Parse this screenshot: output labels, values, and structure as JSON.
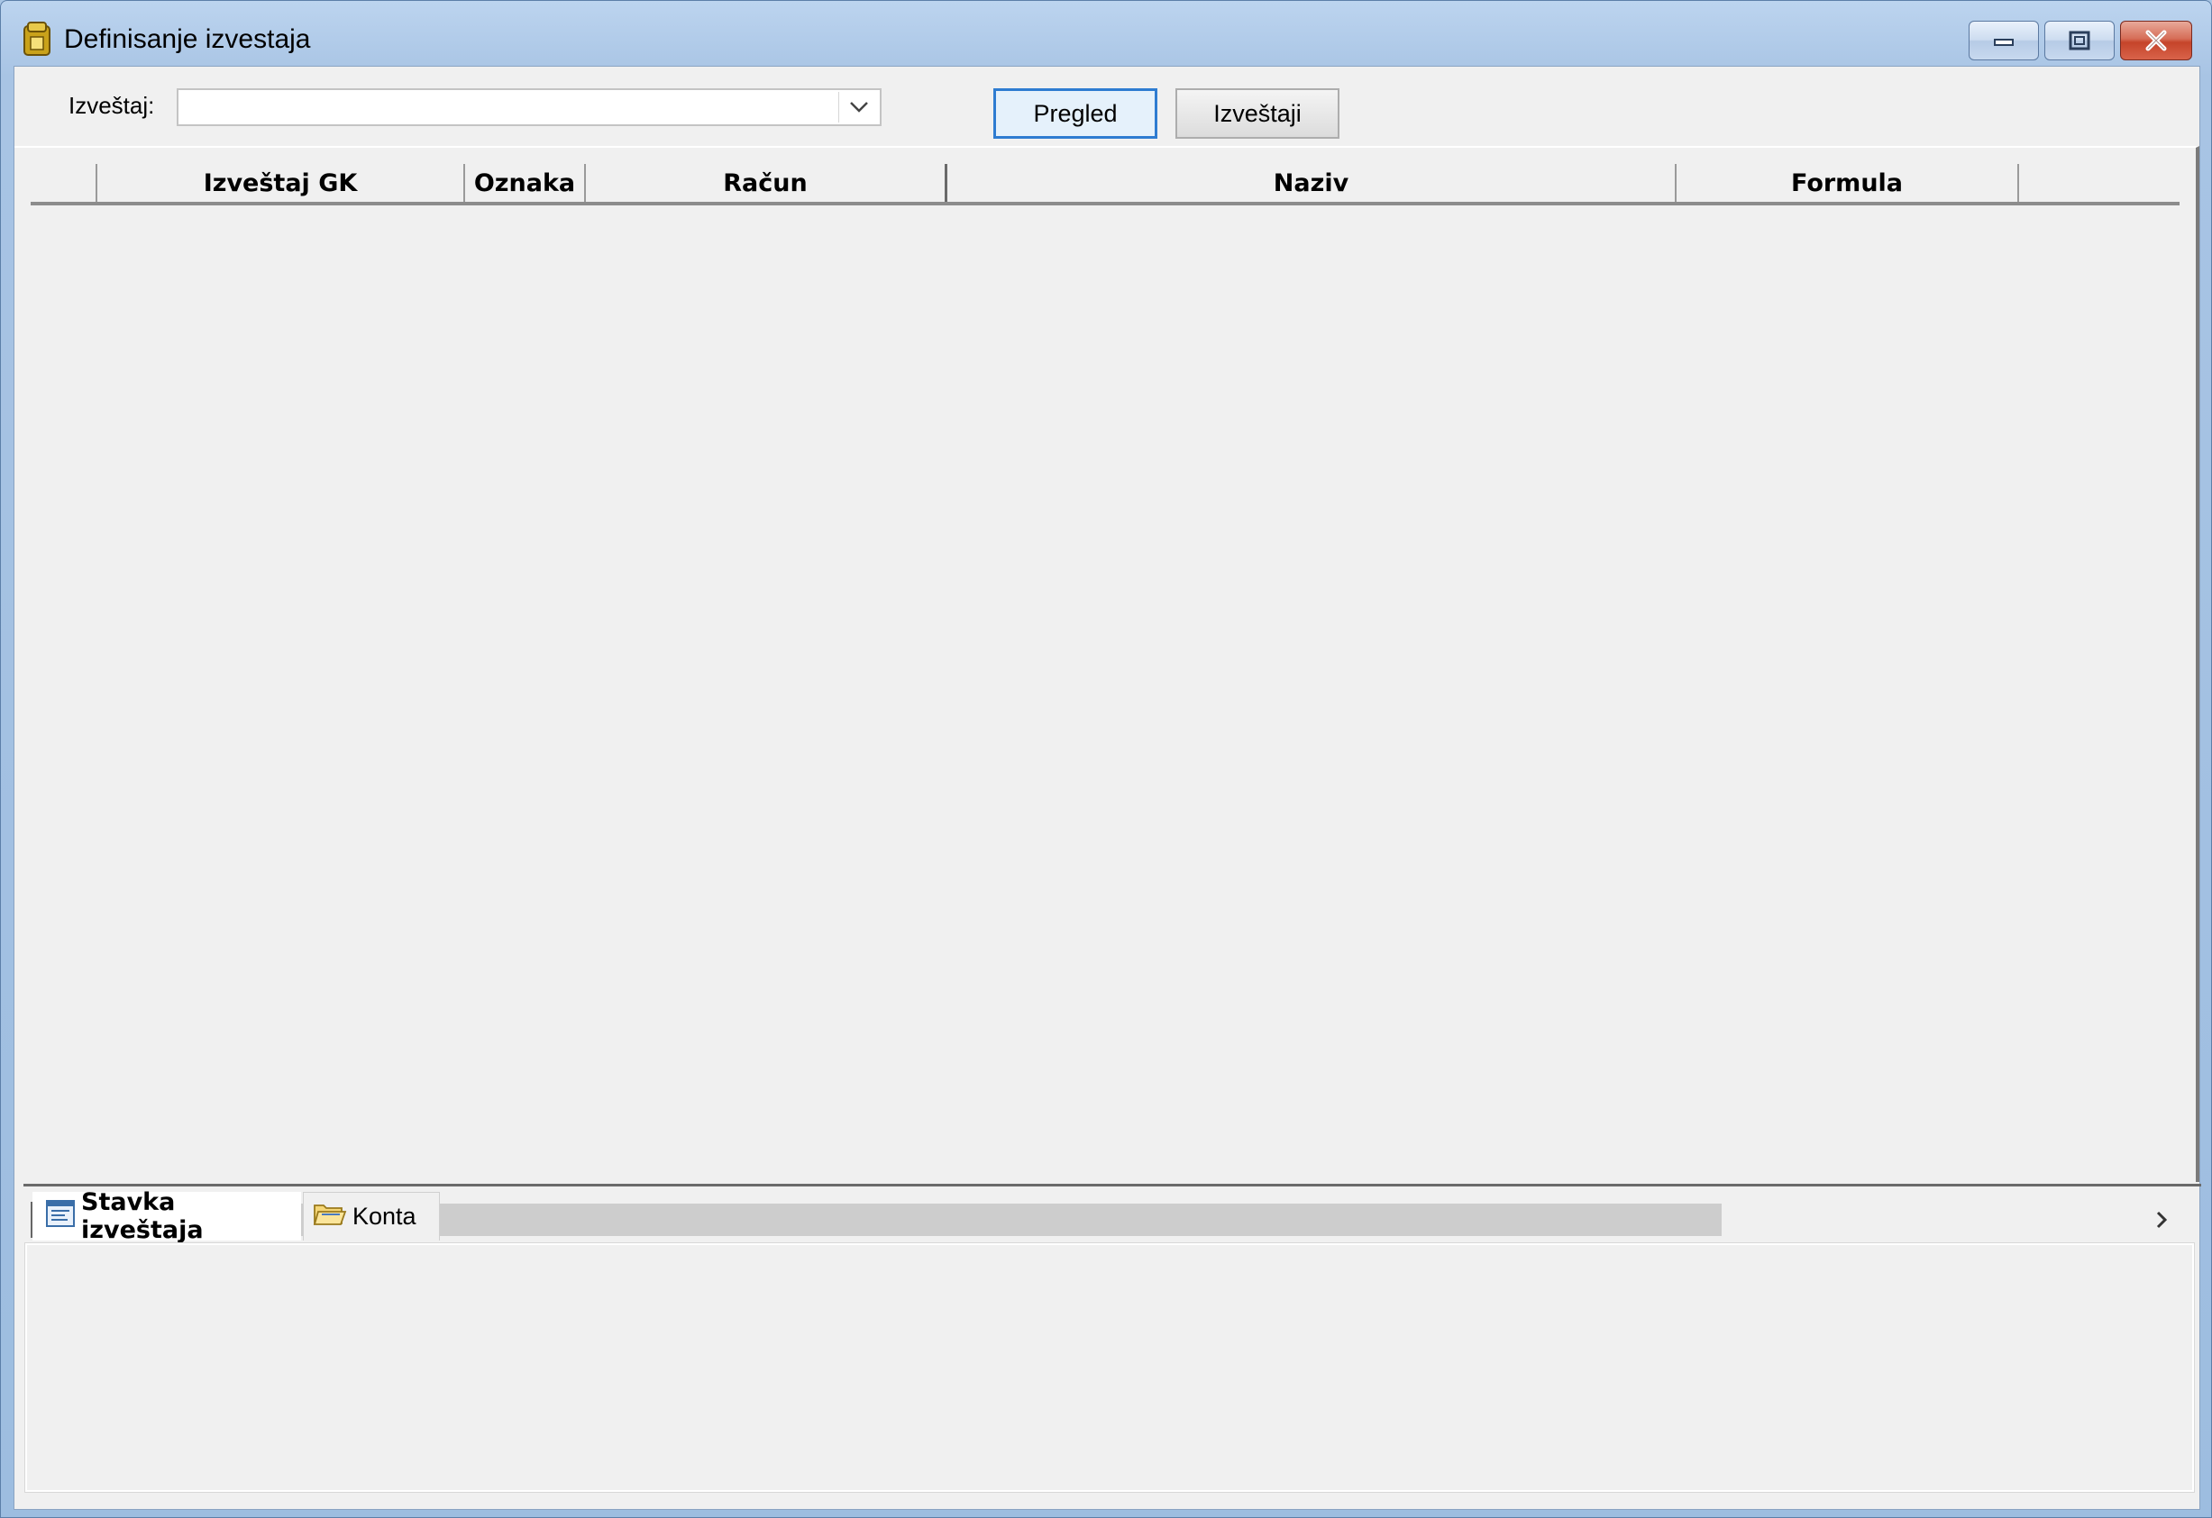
{
  "window": {
    "title": "Definisanje izvestaja",
    "app_icon": "report-app-icon"
  },
  "toolbar": {
    "report_label": "Izveštaj:",
    "report_value": "",
    "preview_label": "Pregled",
    "reports_label": "Izveštaji"
  },
  "grid": {
    "columns": [
      "Izveštaj GK",
      "Oznaka",
      "Račun",
      "Naziv",
      "Formula",
      ""
    ],
    "rows": []
  },
  "tabs": {
    "items": [
      {
        "label": "Stavka izveštaja",
        "icon": "form-icon",
        "active": true
      },
      {
        "label": "Konta",
        "icon": "folder-icon",
        "active": false
      }
    ]
  },
  "colors": {
    "accent": "#2e7cd1",
    "close_button": "#c5442a",
    "background": "#f0f0f0"
  }
}
